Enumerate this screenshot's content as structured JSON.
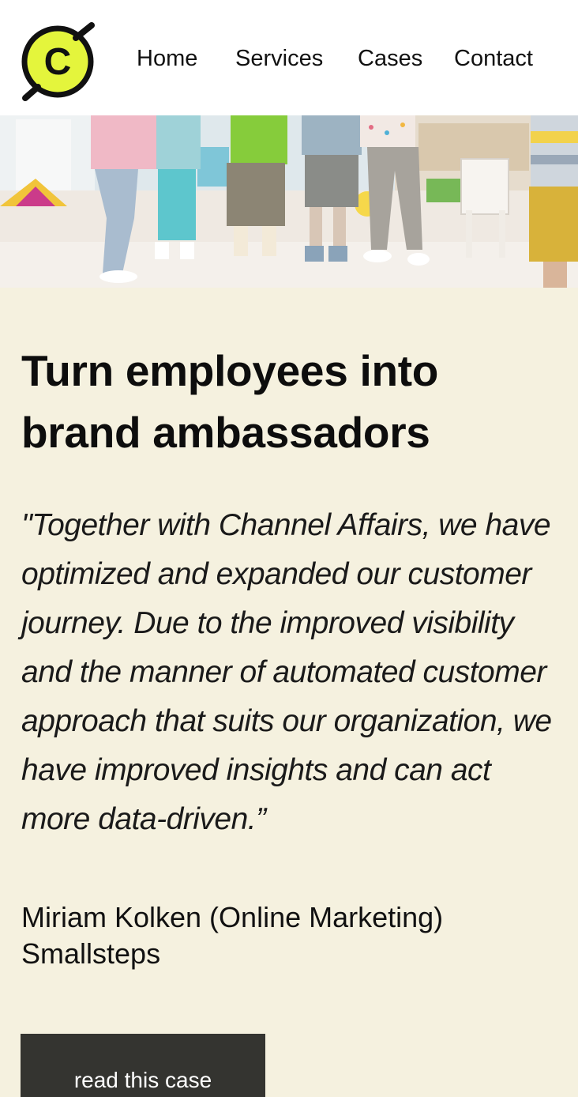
{
  "brand": {
    "logo_letter": "C",
    "logo_color": "#e4f53c"
  },
  "nav": {
    "home": "Home",
    "services": "Services",
    "cases": "Cases",
    "contact": "Contact"
  },
  "case": {
    "title": "Turn employees into brand ambassadors",
    "quote": "\"Together with Channel Affairs, we have optimized and expanded our customer journey. Due to the improved visibility and the manner of automated customer approach that suits our organization, we have improved insights and can act more data-driven.”",
    "author": "Miriam Kolken (Online Marketing)",
    "company": "Smallsteps",
    "cta_label": "read this case"
  },
  "colors": {
    "page_bg": "#f5f1df",
    "button_bg": "#343430",
    "text": "#111111"
  }
}
